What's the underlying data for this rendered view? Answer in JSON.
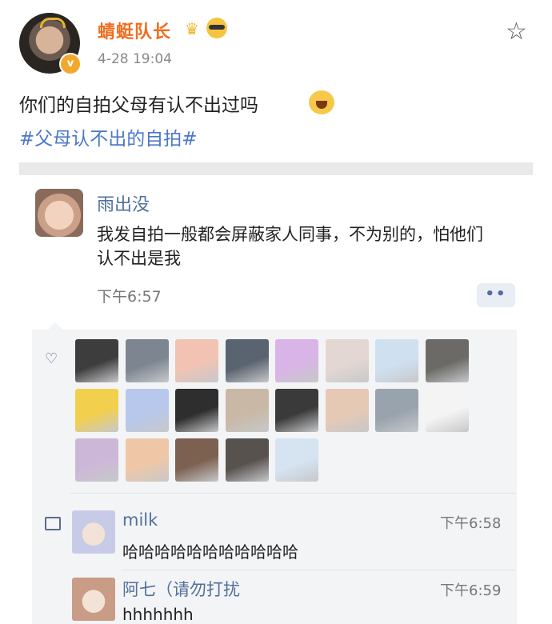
{
  "post": {
    "username": "蜻蜓队长",
    "badge_letter": "v",
    "time": "4-28 19:04",
    "text": "你们的自拍父母有认不出过吗",
    "hashtag": "#父母认不出的自拍#",
    "icons": [
      "star-icon",
      "crown-emoji",
      "cool-cat-emoji",
      "crying-laughing-emoji"
    ]
  },
  "comment": {
    "author": "雨出没",
    "text": "我发自拍一般都会屏蔽家人同事，不为别的，怕他们认不出是我",
    "time": "下午6:57",
    "more_label": "••"
  },
  "likes": {
    "icon": "heart-icon",
    "avatar_colors": [
      "#3d3d3d",
      "#7d8690",
      "#f2c3b3",
      "#5a6470",
      "#d9b4e6",
      "#e3d7d3",
      "#cfe0f0",
      "#6b6a66",
      "#f2d04e",
      "#b7c8ec",
      "#2e2e2e",
      "#c9b8a6",
      "#3a3a3a",
      "#e6c9b5",
      "#98a3ad",
      "#f4f4f4",
      "#cdb7d8",
      "#f0c7a6",
      "#7c6050",
      "#58524f",
      "#d6e4f2"
    ]
  },
  "replies": [
    {
      "name": "milk",
      "time": "下午6:58",
      "text": "哈哈哈哈哈哈哈哈哈哈哈",
      "avatar_color": "#c8cbe8"
    },
    {
      "name": "阿七（请勿打扰",
      "time": "下午6:59",
      "text": "hhhhhhh",
      "avatar_color": "#c99c86"
    }
  ]
}
